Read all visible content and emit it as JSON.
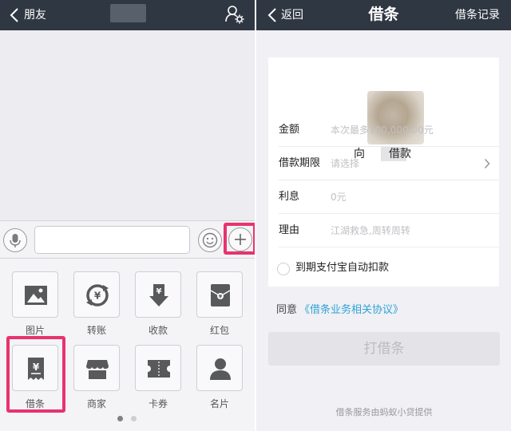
{
  "left_panel": {
    "back_label": "朋友",
    "tools": [
      {
        "label": "图片",
        "icon": "image-icon"
      },
      {
        "label": "转账",
        "icon": "transfer-icon"
      },
      {
        "label": "收款",
        "icon": "receive-money-icon"
      },
      {
        "label": "红包",
        "icon": "red-envelope-icon"
      },
      {
        "label": "借条",
        "icon": "iou-receipt-icon"
      },
      {
        "label": "商家",
        "icon": "shop-icon"
      },
      {
        "label": "卡券",
        "icon": "coupon-icon"
      },
      {
        "label": "名片",
        "icon": "contact-card-icon"
      }
    ],
    "pager": {
      "pages": 2,
      "current": 1
    }
  },
  "right_panel": {
    "back_label": "返回",
    "title": "借条",
    "records_label": "借条记录",
    "to_prefix": "向",
    "to_suffix": "借款",
    "fields": [
      {
        "label": "金额",
        "placeholder": "本次最多100,000.00元"
      },
      {
        "label": "借款期限",
        "placeholder": "请选择"
      },
      {
        "label": "利息",
        "placeholder": "0元"
      },
      {
        "label": "理由",
        "placeholder": "江湖救急,周转周转"
      }
    ],
    "autopay_label": "到期支付宝自动扣款",
    "agree_text": "同意",
    "agree_link": "《借条业务相关协议》",
    "submit_label": "打借条",
    "footer_note": "借条服务由蚂蚁小贷提供"
  },
  "colors": {
    "navbar": "#2f3742",
    "highlight": "#e8336d",
    "link": "#2fa3d6",
    "icon": "#58595b"
  }
}
